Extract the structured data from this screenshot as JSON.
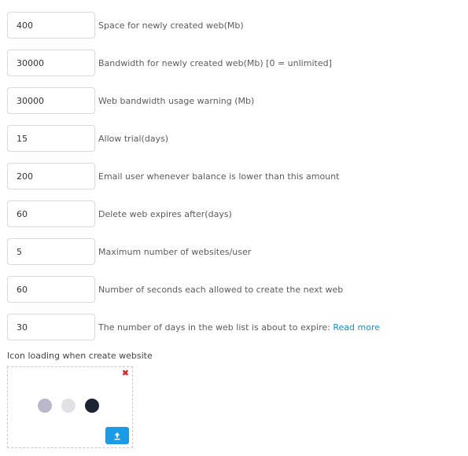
{
  "settings": [
    {
      "value": "400",
      "label": "Space for newly created web(Mb)"
    },
    {
      "value": "30000",
      "label": "Bandwidth for newly created web(Mb) [0 = unlimited]"
    },
    {
      "value": "30000",
      "label": "Web bandwidth usage warning (Mb)"
    },
    {
      "value": "15",
      "label": "Allow trial(days)"
    },
    {
      "value": "200",
      "label": "Email user whenever balance is lower than this amount"
    },
    {
      "value": "60",
      "label": "Delete web expires after(days)"
    },
    {
      "value": "5",
      "label": "Maximum number of websites/user"
    },
    {
      "value": "60",
      "label": "Number of seconds each allowed to create the next web"
    },
    {
      "value": "30",
      "label": "The number of days in the web list is about to expire:",
      "link": "Read more"
    }
  ],
  "icon_loading": {
    "label": "Icon loading when create website",
    "remove_symbol": "✖",
    "remove_icon": "close-icon",
    "upload_icon": "upload-icon",
    "dot_colors": [
      "#b9b9cc",
      "#e2e2e6",
      "#1c2434"
    ]
  },
  "colors": {
    "accent": "#1a9be6",
    "link": "#1a8fd9",
    "remove": "#e01c1c"
  }
}
